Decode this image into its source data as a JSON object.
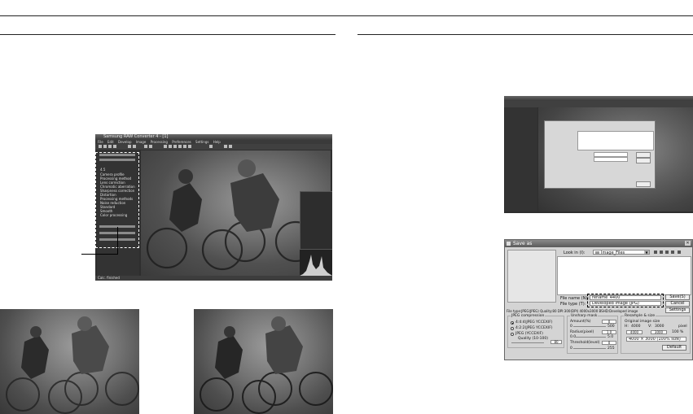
{
  "main_app": {
    "title": "Samsung RAW Converter 4 - [1]",
    "menu": [
      "File",
      "Edit",
      "Develop",
      "Image",
      "Processing",
      "Preferences",
      "Settings",
      "Help"
    ],
    "panel_items": [
      "4.5",
      "Camera profile",
      "Processing method",
      "Lens correction",
      "Chromatic aberration",
      "Sharpness correction",
      "Distortion",
      "Processing methods",
      "Noise reduction",
      "Standard",
      "Smooth",
      "Color processing"
    ],
    "status": "Calc. finished"
  },
  "save_dialog": {
    "title": "Save as",
    "look_in_label": "Look in (I):",
    "look_in_value": "Image_Files",
    "file_name_label": "File name (N):",
    "file_name_value": "rename_4400",
    "file_type_label": "File type (T):",
    "file_type_value": "Developed image (JPG)",
    "info_line": "File type:JPEG(JPEG) Quality:80 DPI:300(DPI) 4000x3000 BSHD:Developed image",
    "buttons": [
      "Save(S)",
      "Cancel",
      "Settings"
    ],
    "jpeg_group": {
      "title": "JPEG compression",
      "options": [
        "4:4:4(JPEG YCCEXIF)",
        "4:2:2(JPEG YCCEXIF)",
        "JPEG (YCCEXIF)"
      ],
      "quality_label": "Quality (10-100)",
      "quality_value": "80"
    },
    "sharpen_group": {
      "title": "Unsharp mask",
      "rows": [
        {
          "label": "Amount(%)",
          "value": "0",
          "min": "0",
          "max": "500"
        },
        {
          "label": "Radius(pixel)",
          "value": "1.0",
          "min": "0.0",
          "max": "5.0"
        },
        {
          "label": "Threshold(level)",
          "value": "0",
          "min": "0",
          "max": "255"
        }
      ]
    },
    "resize_group": {
      "title": "Resample & size",
      "original_label": "Original image size",
      "h_label": "H:",
      "h_value": "4000",
      "v_label": "V:",
      "v_value": "3000",
      "unit": "pixel",
      "w_value": "4000",
      "w2_value": "3000",
      "percent": "100 %",
      "size_text": "4000 × 3000 (100% size)",
      "default_button": "Default"
    }
  }
}
